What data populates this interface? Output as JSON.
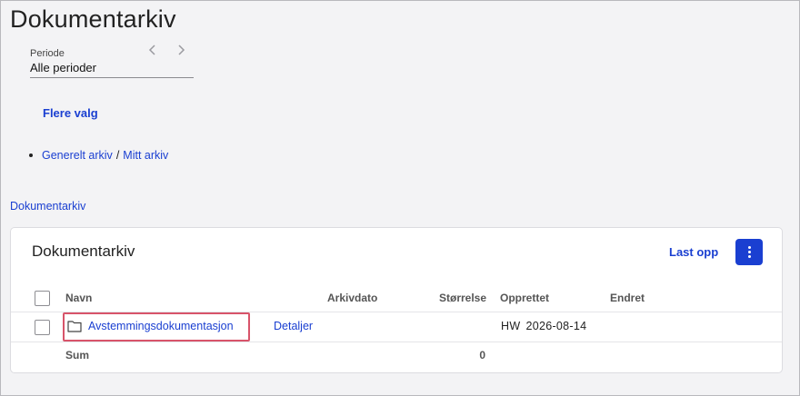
{
  "page": {
    "title": "Dokumentarkiv"
  },
  "period": {
    "label": "Periode",
    "value": "Alle perioder"
  },
  "more_options": "Flere valg",
  "archive_links": {
    "general": "Generelt arkiv",
    "separator": "/",
    "mine": "Mitt arkiv"
  },
  "breadcrumb": "Dokumentarkiv",
  "card": {
    "title": "Dokumentarkiv",
    "upload_label": "Last opp",
    "columns": [
      "Navn",
      "Arkivdato",
      "Størrelse",
      "Opprettet",
      "Endret"
    ],
    "rows": [
      {
        "name": "Avstemmingsdokumentasjon",
        "details": "Detaljer",
        "created_by": "HW",
        "created_date": "2026-08-14",
        "icon": "folder-icon"
      }
    ],
    "sum_label": "Sum",
    "sum_size": "0"
  },
  "colors": {
    "link": "#1a3fd1",
    "highlight_border": "#d8546a"
  }
}
